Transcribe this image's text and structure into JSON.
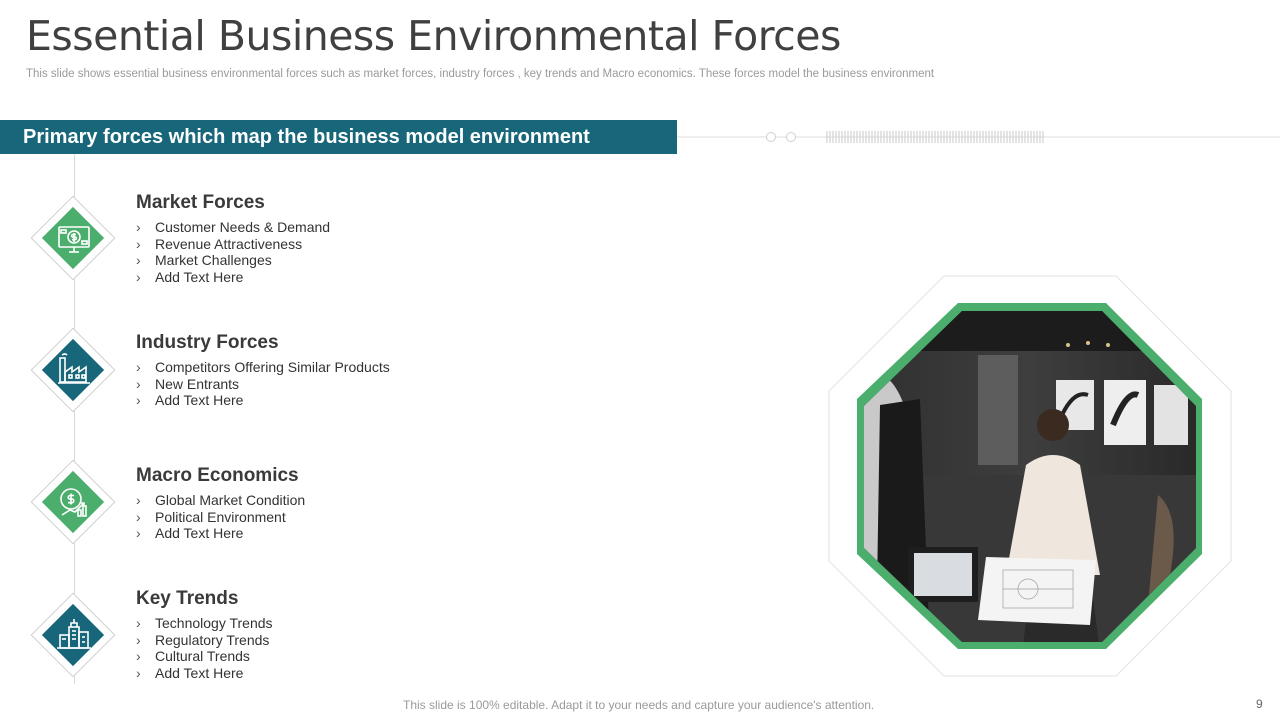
{
  "title": "Essential Business Environmental Forces",
  "subtitle": "This slide shows essential business environmental forces such as market forces, industry forces , key trends and Macro economics. These forces model the business environment",
  "banner": "Primary forces which map the business model environment",
  "sections": [
    {
      "heading": "Market Forces",
      "icon": "money-monitor-icon",
      "items": [
        "Customer Needs & Demand",
        "Revenue Attractiveness",
        "Market Challenges",
        "Add Text Here"
      ]
    },
    {
      "heading": "Industry Forces",
      "icon": "factory-icon",
      "items": [
        "Competitors Offering Similar Products",
        "New  Entrants",
        "Add Text Here"
      ]
    },
    {
      "heading": "Macro Economics",
      "icon": "dollar-growth-icon",
      "items": [
        "Global Market Condition",
        "Political Environment",
        "Add Text Here"
      ]
    },
    {
      "heading": "Key Trends",
      "icon": "city-buildings-icon",
      "items": [
        "Technology Trends",
        "Regulatory Trends",
        "Cultural Trends",
        "Add Text Here"
      ]
    }
  ],
  "bullet_glyph": "›",
  "colors": {
    "accent_teal": "#17667a",
    "accent_green": "#4cae6d"
  },
  "footer": "This slide is 100% editable. Adapt it to your needs and capture your audience's attention.",
  "page_number": "9"
}
